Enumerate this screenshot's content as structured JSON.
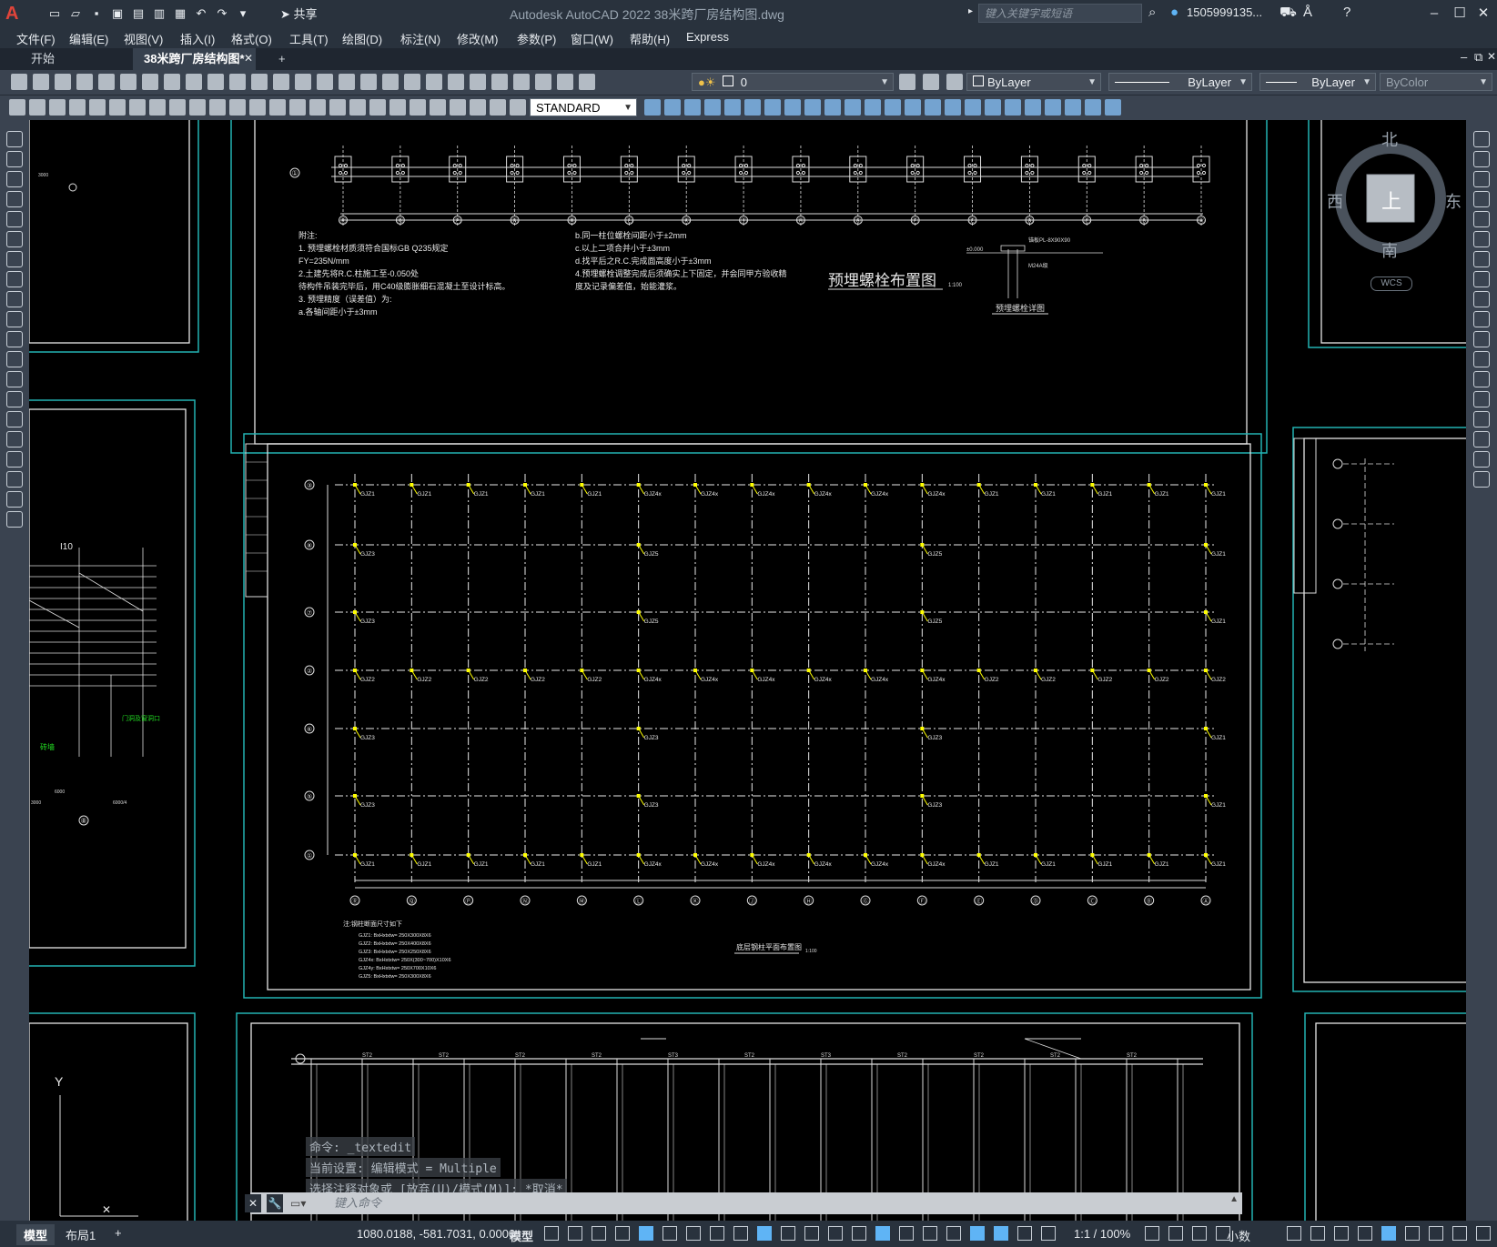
{
  "window": {
    "title": "Autodesk AutoCAD 2022    38米跨厂房结构图.dwg",
    "share_label": "共享",
    "search_placeholder": "键入关键字或短语",
    "user": "1505999135...",
    "logo": "A"
  },
  "menu": [
    "文件(F)",
    "编辑(E)",
    "视图(V)",
    "插入(I)",
    "格式(O)",
    "工具(T)",
    "绘图(D)",
    "标注(N)",
    "修改(M)",
    "参数(P)",
    "窗口(W)",
    "帮助(H)",
    "Express"
  ],
  "file_tabs": [
    {
      "label": "开始",
      "active": false
    },
    {
      "label": "38米跨厂房结构图*",
      "active": true
    },
    {
      "label": "+",
      "active": false
    }
  ],
  "toolbar": {
    "layer_value": "0",
    "color_value": "ByLayer",
    "linetype_value": "ByLayer",
    "lineweight_value": "ByLayer",
    "plotstyle_value": "ByColor",
    "textstyle_value": "STANDARD"
  },
  "viewcube": {
    "north": "北",
    "south": "南",
    "east": "东",
    "west": "西",
    "top": "上",
    "ucs": "WCS"
  },
  "drawing": {
    "top_title": "预埋螺栓布置图",
    "top_scale": "1:100",
    "top_detail_title": "预埋螺栓详图",
    "top_detail_labels": [
      "±0.000",
      "锚板PL-8X90X90",
      "M24A级"
    ],
    "notes_left": [
      "附注:",
      "1. 预埋螺栓材质须符合国标GB Q235规定",
      "   FY=235N/mm",
      "2.土建先将R.C.柱施工至-0.050处",
      "   待构件吊装完毕后，用C40级膨胀细石混凝土至设计标高。",
      "3. 预埋精度（误差值）为:",
      "   a.各轴间距小于±3mm"
    ],
    "notes_right": [
      "b.同一柱位螺栓间距小于±2mm",
      "c.以上二项合并小于±3mm",
      "d.找平后之R.C.完成面高度小于±3mm",
      "4.预埋螺栓调整完成后须确实上下固定，并会同甲方验收精",
      "  度及记录偏差值，始能灌浆。"
    ],
    "main_title": "底层钢柱平面布置图",
    "main_scale": "1:100",
    "main_note_title": "注:钢柱断面尺寸如下",
    "main_note_rows": [
      "GJZ1: BxHxtxtw= 250X300X8X6",
      "GJZ2: BxHxtxtw= 250X400X8X6",
      "GJZ3: BxHxtxtw= 250X250X8X6",
      "GJZ4x: BxHxtxtw= 250X(300~700)X10X6",
      "GJZ4y: BxHxtxtw= 250X700X10X6",
      "GJZ5: BxHxtxtw= 250X300X8X6"
    ],
    "row_axes": [
      "③",
      "⑧",
      "⑦",
      "②",
      "⑥",
      "⑤",
      "①"
    ],
    "col_axes": [
      "Ⓡ",
      "Ⓠ",
      "Ⓟ",
      "Ⓝ",
      "Ⓜ",
      "Ⓛ",
      "Ⓚ",
      "Ⓙ",
      "Ⓗ",
      "Ⓖ",
      "Ⓕ",
      "Ⓔ",
      "Ⓓ",
      "Ⓒ",
      "Ⓑ",
      "Ⓐ"
    ],
    "row1_labels": [
      "GJZ1",
      "GJZ1",
      "GJZ1",
      "GJZ1",
      "GJZ1",
      "GJZ4x",
      "GJZ4x",
      "GJZ4x",
      "GJZ4x",
      "GJZ4x",
      "GJZ4x",
      "GJZ1",
      "GJZ1",
      "GJZ1",
      "GJZ1",
      "GJZ1"
    ],
    "row4_labels": [
      "GJZ2",
      "GJZ2",
      "GJZ2",
      "GJZ2",
      "GJZ2",
      "GJZ4x",
      "GJZ4x",
      "GJZ4x",
      "GJZ4x",
      "GJZ4x",
      "GJZ4x",
      "GJZ2",
      "GJZ2",
      "GJZ2",
      "GJZ2",
      "GJZ2"
    ],
    "side_labels": {
      "left": [
        "GJZ3",
        "GJZ3",
        "GJZ3",
        "GJZ3"
      ],
      "mid1": [
        "GJZ5",
        "GJZ5",
        "GJZ3",
        "GJZ3"
      ],
      "mid2": [
        "GJZ5",
        "GJZ5",
        "GJZ3",
        "GJZ3"
      ],
      "right": [
        "GJZ1",
        "GJZ1",
        "GJZ1",
        "GJZ1"
      ]
    },
    "left_fragment": {
      "beam_label": "I10",
      "green_label1": "砖墙",
      "green_label2": "门洞及窗洞口",
      "dims": [
        "3000",
        "6000",
        "3000",
        "6000/4"
      ],
      "axis": "⑧"
    },
    "bottom_fragment_labels": [
      "ST2",
      "ST2",
      "ST2",
      "ST2",
      "ST3",
      "ST2",
      "ST3",
      "ST2",
      "ST2",
      "ST2",
      "ST2"
    ],
    "bottom_left_axis": "Y"
  },
  "command": {
    "history": [
      "命令: _textedit",
      "当前设置: 编辑模式 = Multiple",
      "选择注释对象或 [放弃(U)/模式(M)]: *取消*"
    ],
    "placeholder": "键入命令"
  },
  "status": {
    "tabs": [
      {
        "label": "模型",
        "active": true
      },
      {
        "label": "布局1",
        "active": false
      },
      {
        "label": "+",
        "active": false
      }
    ],
    "coords": "1080.0188, -581.7031, 0.0000",
    "space": "模型",
    "scale": "1:1 / 100%",
    "units": "小数"
  },
  "colors": {
    "frame_cyan": "#22b3b3",
    "grid_white": "#e8e8e8",
    "column_yellow": "#ffff00",
    "green_text": "#22dd22"
  }
}
